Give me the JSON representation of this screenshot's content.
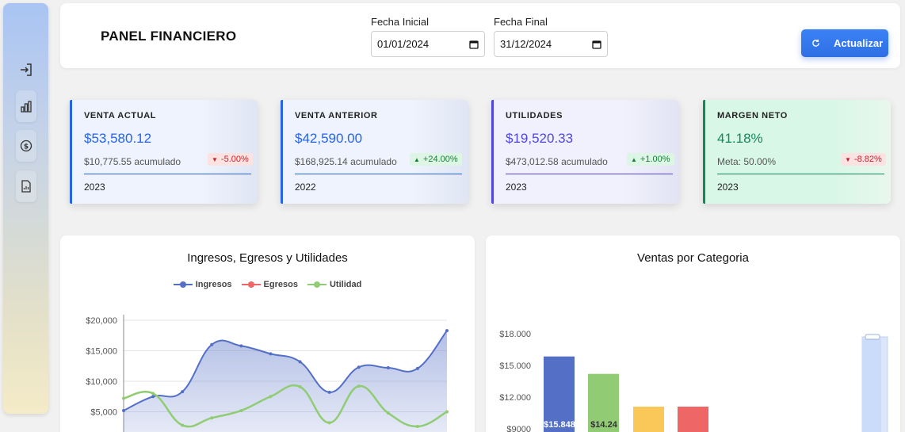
{
  "header": {
    "title": "PANEL FINANCIERO",
    "start_label": "Fecha Inicial",
    "start_value": "01/01/2024",
    "end_label": "Fecha Final",
    "end_value": "31/12/2024",
    "refresh_label": "Actualizar"
  },
  "sidebar": {
    "items": [
      {
        "icon": "login-icon"
      },
      {
        "icon": "bar-chart-icon"
      },
      {
        "icon": "dollar-icon"
      },
      {
        "icon": "report-icon"
      }
    ]
  },
  "kpis": [
    {
      "title": "VENTA ACTUAL",
      "value": "$53,580.12",
      "sub": "$10,775.55 acumulado",
      "badge": "-5.00%",
      "trend": "down",
      "year": "2023",
      "accent": "#2563eb"
    },
    {
      "title": "VENTA ANTERIOR",
      "value": "$42,590.00",
      "sub": "$168,925.14 acumulado",
      "badge": "+24.00%",
      "trend": "up",
      "year": "2022",
      "accent": "#2563eb"
    },
    {
      "title": "UTILIDADES",
      "value": "$19,520.33",
      "sub": "$473,012.58 acumulado",
      "badge": "+1.00%",
      "trend": "up",
      "year": "2023",
      "accent": "#4f46e5"
    },
    {
      "title": "MARGEN NETO",
      "value": "41.18%",
      "sub": "Meta: 50.00%",
      "badge": "-8.82%",
      "trend": "down",
      "year": "2023",
      "accent": "#15885a"
    }
  ],
  "chart_data": [
    {
      "type": "line",
      "title": "Ingresos, Egresos y Utilidades",
      "yticks": [
        "$20,000",
        "$15,000",
        "$10,000",
        "$5,000"
      ],
      "ylim": [
        0,
        21000
      ],
      "series": [
        {
          "name": "Ingresos",
          "color": "#5470c6",
          "values": [
            5200,
            7500,
            8300,
            16000,
            15800,
            14500,
            13200,
            8200,
            12300,
            12200,
            12100,
            18300
          ]
        },
        {
          "name": "Egresos",
          "color": "#ee6666",
          "values": []
        },
        {
          "name": "Utilidad",
          "color": "#91cc75",
          "values": [
            7200,
            8000,
            2800,
            4000,
            5200,
            7500,
            9100,
            3200,
            9200,
            4800,
            2600,
            5000
          ]
        }
      ],
      "grid": true,
      "legend": "top-center"
    },
    {
      "type": "bar",
      "title": "Ventas por Categoria",
      "yticks": [
        "$18.000",
        "$15.000",
        "$12.000",
        "$9000"
      ],
      "ylim": [
        9000,
        18000
      ],
      "values": [
        15848,
        14200,
        11100,
        11100
      ],
      "data_labels": [
        "$15.848",
        "$14.24"
      ],
      "colors": [
        "#5470c6",
        "#91cc75",
        "#fac858",
        "#ee6666"
      ]
    }
  ]
}
